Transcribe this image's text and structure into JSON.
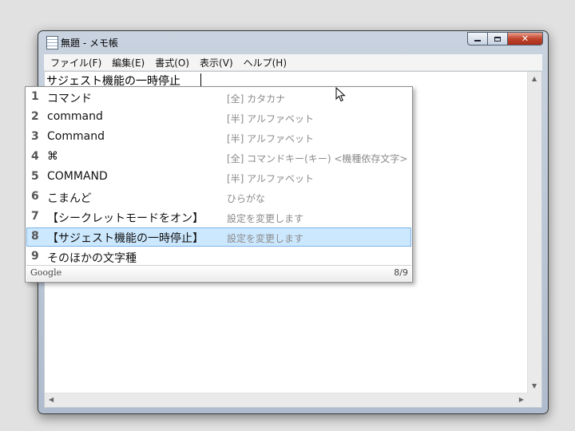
{
  "window": {
    "title": "無題 - メモ帳",
    "caption": {
      "minimize": "",
      "maximize": "",
      "close": "✕"
    }
  },
  "menu": [
    "ファイル(F)",
    "編集(E)",
    "書式(O)",
    "表示(V)",
    "ヘルプ(H)"
  ],
  "editor": {
    "composition_text": "サジェスト機能の一時停止"
  },
  "ime_popup": {
    "candidates": [
      {
        "num": "1",
        "text": "コマンド",
        "desc": "[全] カタカナ"
      },
      {
        "num": "2",
        "text": "command",
        "desc": "[半] アルファベット"
      },
      {
        "num": "3",
        "text": "Command",
        "desc": "[半] アルファベット"
      },
      {
        "num": "4",
        "text": "⌘",
        "desc": "[全] コマンドキー(キー) <機種依存文字>"
      },
      {
        "num": "5",
        "text": "COMMAND",
        "desc": "[半] アルファベット"
      },
      {
        "num": "6",
        "text": "こまんど",
        "desc": "ひらがな"
      },
      {
        "num": "7",
        "text": "【シークレットモードをオン】",
        "desc": "設定を変更します"
      },
      {
        "num": "8",
        "text": "【サジェスト機能の一時停止】",
        "desc": "設定を変更します"
      },
      {
        "num": "9",
        "text": "そのほかの文字種",
        "desc": ""
      }
    ],
    "selected_index": 8,
    "footer_brand": "Google",
    "footer_count": "8/9"
  },
  "colors": {
    "selection": "#cce8ff",
    "selection_border": "#7ab3e8",
    "description": "#8a8a8a",
    "close_button": "#c2442c"
  }
}
